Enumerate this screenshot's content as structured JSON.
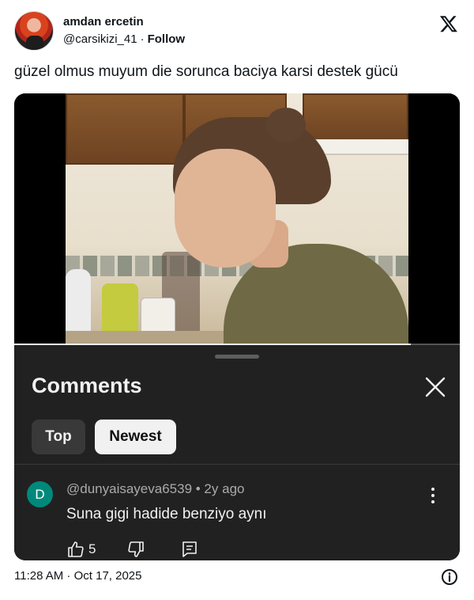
{
  "author": {
    "name": "amdan ercetin",
    "handle": "@carsikizi_41",
    "separator": "·",
    "follow_label": "Follow",
    "avatar_icon": "profile-avatar-photo"
  },
  "brand_icon": "x-logo-icon",
  "tweet": {
    "text": "güzel olmus muyum die sorunca baciya karsi destek gücü"
  },
  "video": {
    "progress_fraction": 0.89
  },
  "comments_panel": {
    "title": "Comments",
    "close_icon": "close-icon",
    "sort_options": [
      {
        "label": "Top",
        "selected": false
      },
      {
        "label": "Newest",
        "selected": true
      }
    ],
    "comment": {
      "avatar_letter": "D",
      "avatar_color": "#00897b",
      "meta": "@dunyaisayeva6539 • 2y ago",
      "text": "Suna gigi  hadide benziyo aynı",
      "like_count": "5",
      "icons": [
        "thumbs-up-icon",
        "thumbs-down-icon",
        "reply-icon",
        "more-options-icon"
      ]
    }
  },
  "footer": {
    "timestamp": "11:28 AM · Oct 17, 2025",
    "info_icon": "info-icon"
  },
  "colors": {
    "sheet_background": "#212121",
    "chip_selected": "#f1f1f1",
    "chip_unselected": "#393939",
    "text_dark": "#0f1419"
  }
}
